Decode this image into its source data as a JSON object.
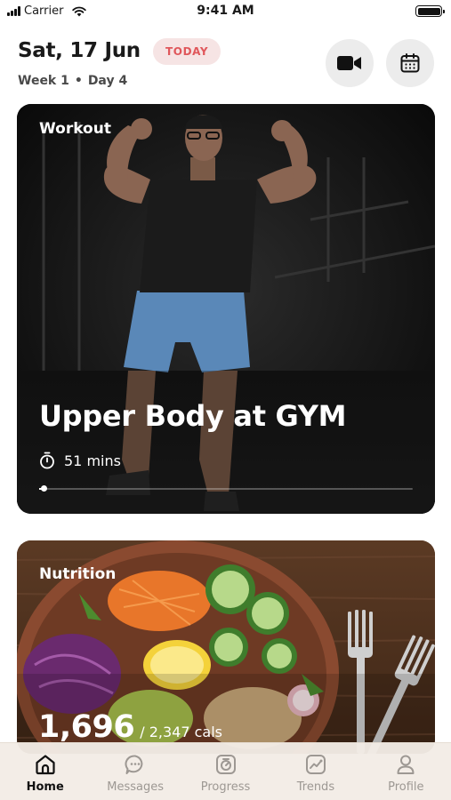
{
  "status_bar": {
    "carrier": "Carrier",
    "time": "9:41 AM"
  },
  "header": {
    "date": "Sat, 17 Jun",
    "today_badge": "TODAY",
    "week": "Week 1",
    "separator": "•",
    "day": "Day 4",
    "video_icon": "video-camera-icon",
    "calendar_icon": "calendar-icon"
  },
  "workout_card": {
    "tag": "Workout",
    "title": "Upper Body at GYM",
    "duration": "51 mins",
    "progress": 0.01
  },
  "nutrition_card": {
    "tag": "Nutrition",
    "calories_consumed": "1,696",
    "separator": "/",
    "calories_goal": "2,347",
    "unit": "cals"
  },
  "tabs": [
    {
      "label": "Home",
      "icon": "home-icon",
      "active": true
    },
    {
      "label": "Messages",
      "icon": "chat-bubble-icon",
      "active": false
    },
    {
      "label": "Progress",
      "icon": "progress-icon",
      "active": false
    },
    {
      "label": "Trends",
      "icon": "trends-chart-icon",
      "active": false
    },
    {
      "label": "Profile",
      "icon": "person-icon",
      "active": false
    }
  ],
  "colors": {
    "accent": "#e0575b",
    "badge_bg": "#f6e4e4",
    "tab_bar_bg": "#f2ece6",
    "tab_active": "#111111",
    "tab_inactive": "#9d9893"
  }
}
